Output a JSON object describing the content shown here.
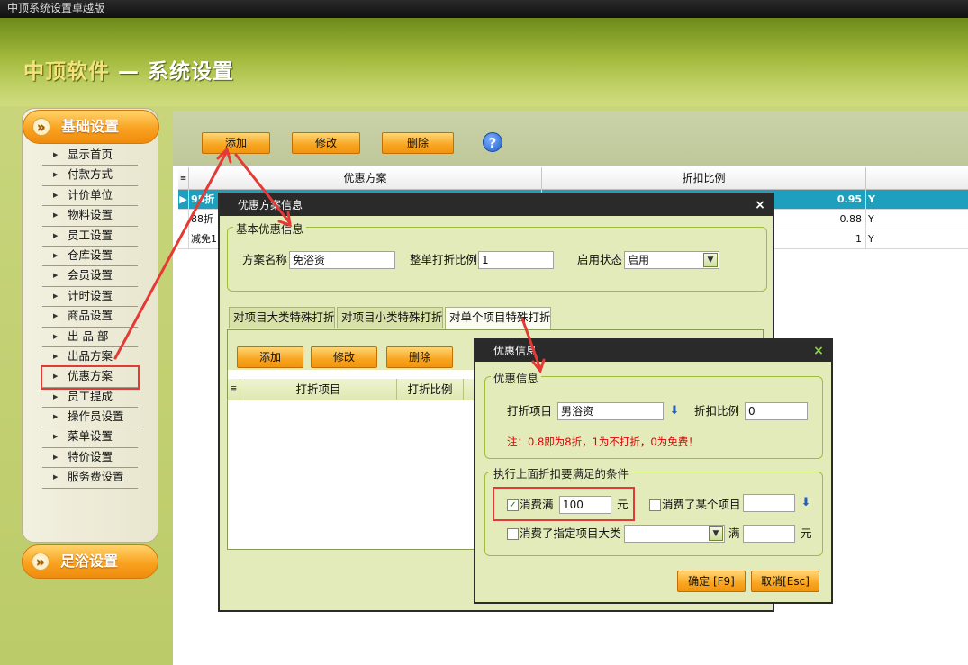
{
  "window": {
    "title": "中顶系统设置卓越版"
  },
  "header": {
    "brand": "中顶软件",
    "separator": " — ",
    "title": "系统设置"
  },
  "sidebar": {
    "category_top": "基础设置",
    "category_bottom": "足浴设置",
    "items": [
      "显示首页",
      "付款方式",
      "计价单位",
      "物料设置",
      "员工设置",
      "仓库设置",
      "会员设置",
      "计时设置",
      "商品设置",
      "出 品 部",
      "出品方案",
      "优惠方案",
      "员工提成",
      "操作员设置",
      "菜单设置",
      "特价设置",
      "服务费设置"
    ],
    "active_index": 11
  },
  "toolbar": {
    "add_label": "添加",
    "edit_label": "修改",
    "delete_label": "删除",
    "help_glyph": "?"
  },
  "grid": {
    "columns": [
      "优惠方案",
      "折扣比例"
    ],
    "rows": [
      {
        "name": "95折",
        "ratio": "0.95",
        "flag": "Y"
      },
      {
        "name": "88折",
        "ratio": "0.88",
        "flag": "Y"
      },
      {
        "name": "减免1",
        "ratio": "1",
        "flag": "Y"
      }
    ]
  },
  "dialog1": {
    "title": "优惠方案信息",
    "close_glyph": "×",
    "basic_legend": "基本优惠信息",
    "name_label": "方案名称",
    "name_value": "免浴资",
    "ratio_label": "整单打折比例",
    "ratio_value": "1",
    "status_label": "启用状态",
    "status_value": "启用",
    "tabs": [
      "对项目大类特殊打折",
      "对项目小类特殊打折",
      "对单个项目特殊打折"
    ],
    "active_tab": 2,
    "toolbar": {
      "add_label": "添加",
      "edit_label": "修改",
      "delete_label": "删除"
    },
    "sub_columns": [
      "打折项目",
      "打折比例"
    ]
  },
  "dialog2": {
    "title": "优惠信息",
    "close_glyph": "×",
    "info_legend": "优惠信息",
    "item_label": "打折项目",
    "item_value": "男浴资",
    "ratio_label": "折扣比例",
    "ratio_value": "0",
    "note": "注：0.8即为8折，1为不打折，0为免费！",
    "cond_legend": "执行上面折扣要满足的条件",
    "cond_amount_label": "消费满",
    "cond_amount_checked": true,
    "cond_amount_value": "100",
    "unit": "元",
    "cond_item_label": "消费了某个项目",
    "cond_item_value": "",
    "cond_cat_label": "消费了指定项目大类",
    "cond_cat_value": "",
    "cond_cat_full": "满",
    "cond_cat_amount": "",
    "ok_label": "确定 [F9]",
    "cancel_label": "取消[Esc]"
  },
  "colors": {
    "accent_orange": "#f8a51f",
    "header_green": "#a2b93c",
    "selected_row": "#1e9fbd",
    "annotation_red": "#e53935"
  }
}
